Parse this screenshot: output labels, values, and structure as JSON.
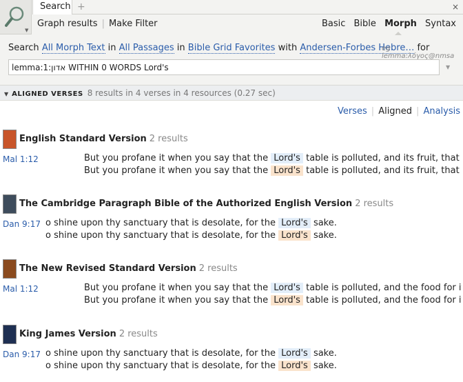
{
  "tab": {
    "label": "Search",
    "add": "+",
    "close": "×"
  },
  "toolbar": {
    "graph": "Graph results",
    "filter": "Make Filter"
  },
  "modes": {
    "basic": "Basic",
    "bible": "Bible",
    "morph": "Morph",
    "syntax": "Syntax"
  },
  "search_line": {
    "prefix": "Search",
    "text": "All Morph Text",
    "in1": "in",
    "passages": "All Passages",
    "in2": "in",
    "favorites": "Bible Grid Favorites",
    "with": "with",
    "morph": "Andersen-Forbes Hebre…",
    "for": "for",
    "example": "eg lemma:λόγος@nmsa"
  },
  "query": {
    "value": "lemma:1:אדון WITHIN 0 WORDS Lord's"
  },
  "results": {
    "heading": "ALIGNED VERSES",
    "summary": "8 results in 4 verses in 4 resources (0.27 sec)"
  },
  "views": {
    "verses": "Verses",
    "aligned": "Aligned",
    "analysis": "Analysis"
  },
  "resources": [
    {
      "title": "English Standard Version",
      "count": "2 results",
      "ref": "Mal  1:12",
      "line1_pre": "But you profane it when you say that the",
      "hl": "Lord's",
      "line1_post": "table is polluted, and its fruit, that is, its food may b",
      "line2_pre": "But you profane it when you say that the",
      "line2_post": "table is polluted, and its fruit, that is, its food may b"
    },
    {
      "title": "The Cambridge Paragraph Bible of the Authorized English Version",
      "count": "2 results",
      "ref": "Dan 9:17",
      "line1_pre": "o shine upon thy sanctuary that is desolate, for the",
      "hl": "Lord's",
      "line1_post": "sake.",
      "line2_pre": "o shine upon thy sanctuary that is desolate, for the",
      "line2_post": "sake."
    },
    {
      "title": "The New Revised Standard Version",
      "count": "2 results",
      "ref": "Mal  1:12",
      "line1_pre": "But you profane it when you say that the",
      "hl": "Lord's",
      "line1_post": "table is polluted, and the food for it may be despise",
      "line2_pre": "But you profane it when you say that the",
      "line2_post": "table is polluted, and the food for it may be despise"
    },
    {
      "title": "King James Version",
      "count": "2 results",
      "ref": "Dan 9:17",
      "line1_pre": "o shine upon thy sanctuary that is desolate, for the",
      "hl": "Lord's",
      "line1_post": "sake.",
      "line2_pre": "o shine upon thy sanctuary that is desolate, for the",
      "line2_post": "sake."
    }
  ]
}
